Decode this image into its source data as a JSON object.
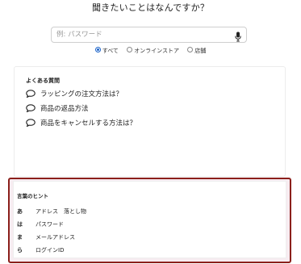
{
  "heading": "聞きたいことはなんですか？",
  "search": {
    "placeholder": "例: パスワード",
    "value": ""
  },
  "filters": [
    {
      "label": "すべて",
      "selected": true
    },
    {
      "label": "オンラインストア",
      "selected": false
    },
    {
      "label": "店舗",
      "selected": false
    }
  ],
  "faq": {
    "title": "よくある質問",
    "items": [
      {
        "label": "ラッピングの注文方法は？"
      },
      {
        "label": "商品の返品方法"
      },
      {
        "label": "商品をキャンセルする方法は？"
      }
    ]
  },
  "hints": {
    "title": "言葉のヒント",
    "rows": [
      {
        "kana": "あ",
        "words": "アドレス　落とし物"
      },
      {
        "kana": "は",
        "words": "パスワード"
      },
      {
        "kana": "ま",
        "words": "メールアドレス"
      },
      {
        "kana": "ら",
        "words": "ログインID"
      }
    ]
  },
  "colors": {
    "accent": "#1a62c9",
    "highlight_border": "#8b1f1b",
    "highlight_bg": "#f7ecf1"
  }
}
